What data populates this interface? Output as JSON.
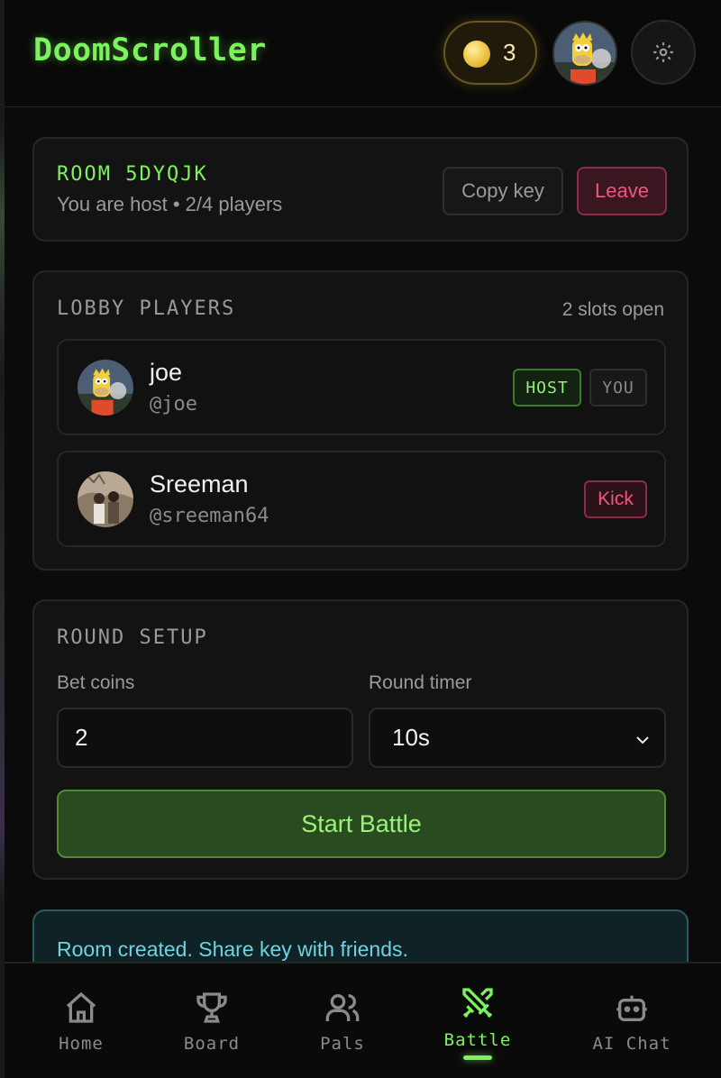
{
  "header": {
    "brand": "DoomScroller",
    "coins": "3",
    "icons": {
      "coin": "coin-icon",
      "avatar": "user-avatar",
      "settings": "gear-icon"
    }
  },
  "room": {
    "title": "ROOM 5DYQJK",
    "subtitle": "You are host • 2/4 players",
    "copy_label": "Copy key",
    "leave_label": "Leave"
  },
  "lobby": {
    "title": "LOBBY PLAYERS",
    "slots_open": "2 slots open",
    "players": [
      {
        "name": "joe",
        "handle": "@joe",
        "tags": [
          "HOST",
          "YOU"
        ]
      },
      {
        "name": "Sreeman",
        "handle": "@sreeman64",
        "action": "Kick"
      }
    ]
  },
  "setup": {
    "title": "ROUND SETUP",
    "bet_label": "Bet coins",
    "bet_value": "2",
    "timer_label": "Round timer",
    "timer_value": "10s",
    "start_label": "Start Battle"
  },
  "toast": {
    "message": "Room created. Share key with friends."
  },
  "nav": {
    "items": [
      {
        "label": "Home",
        "icon": "home-icon"
      },
      {
        "label": "Board",
        "icon": "trophy-icon"
      },
      {
        "label": "Pals",
        "icon": "users-icon"
      },
      {
        "label": "Battle",
        "icon": "swords-icon",
        "active": true
      },
      {
        "label": "AI Chat",
        "icon": "bot-icon"
      }
    ]
  },
  "colors": {
    "accent_green": "#7cf25e",
    "danger_pink": "#f0567d",
    "info_cyan": "#6fd3e0",
    "gold": "#f2c94c"
  }
}
